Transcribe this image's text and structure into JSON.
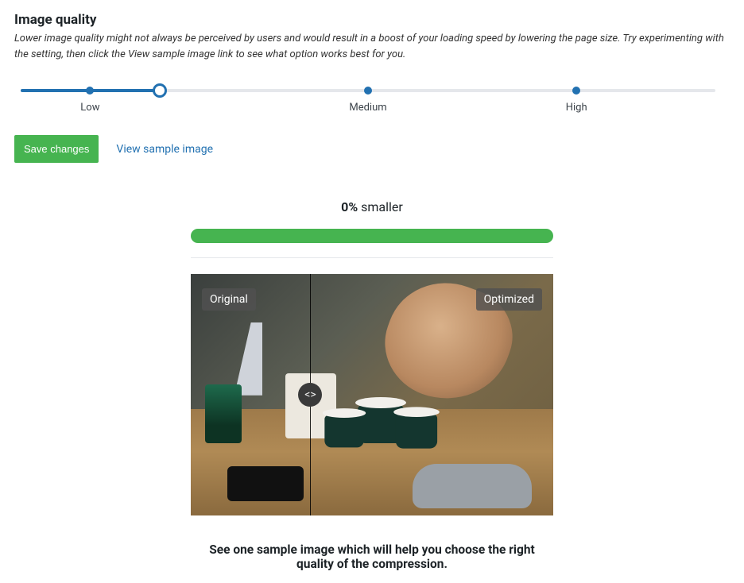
{
  "section": {
    "title": "Image quality",
    "description": "Lower image quality might not always be perceived by users and would result in a boost of your loading speed by lowering the page size. Try experimenting with the setting, then click the View sample image link to see what option works best for you."
  },
  "slider": {
    "labels": {
      "low": "Low",
      "medium": "Medium",
      "high": "High"
    },
    "positions": {
      "low": 10,
      "medium": 50,
      "high": 80,
      "handle": 20
    }
  },
  "actions": {
    "save_label": "Save changes",
    "view_sample_label": "View sample image"
  },
  "comparison": {
    "percent_text": "0%",
    "smaller_word": " smaller",
    "original_label": "Original",
    "optimized_label": "Optimized",
    "drag_glyph": "<>",
    "caption": "See one sample image which will help you choose the right quality of the compression."
  }
}
